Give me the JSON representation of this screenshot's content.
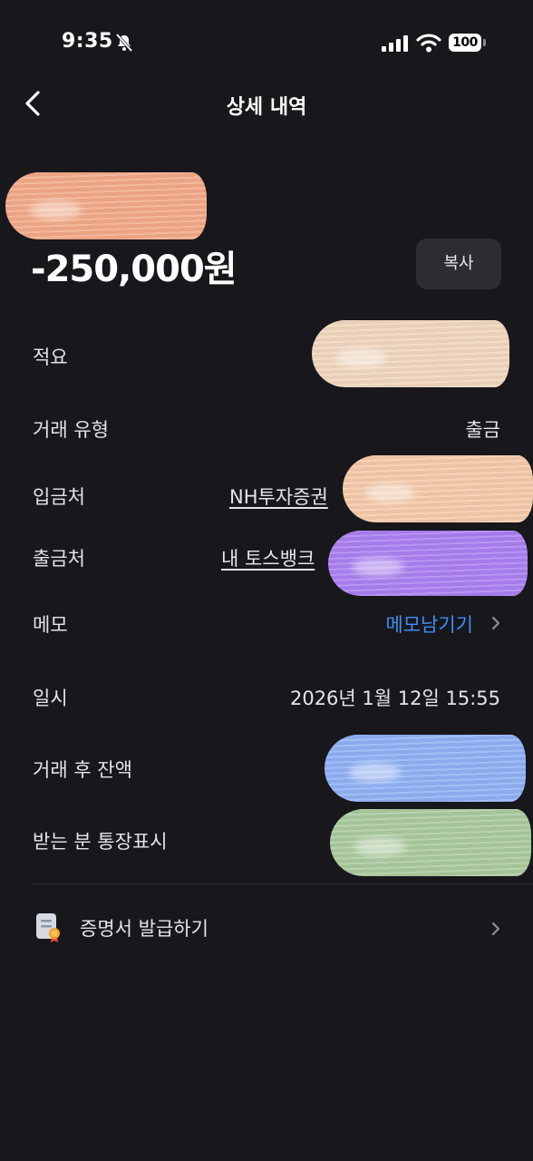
{
  "status_bar": {
    "time": "9:35",
    "battery": "100",
    "icons": [
      "bell-slash-icon",
      "cellular-signal-icon",
      "wifi-icon",
      "battery-icon"
    ]
  },
  "header": {
    "title": "상세 내역",
    "back_icon": "chevron-left-icon"
  },
  "transaction": {
    "amount": "-250,000원",
    "copy_label": "복사"
  },
  "details": {
    "summary_label": "적요",
    "type_label": "거래 유형",
    "type_value": "출금",
    "deposit_to_label": "입금처",
    "deposit_to_value": "NH투자증권",
    "withdraw_from_label": "출금처",
    "withdraw_from_value": "내 토스뱅크",
    "memo_label": "메모",
    "memo_action": "메모남기기",
    "datetime_label": "일시",
    "datetime_value": "2026년 1월 12일 15:55",
    "balance_after_label": "거래 후 잔액",
    "recipient_display_label": "받는 분 통장표시"
  },
  "certificate": {
    "label": "증명서 발급하기",
    "icon": "document-certificate-icon"
  },
  "colors": {
    "background": "#18171c",
    "accent_link": "#3e8ef6",
    "button_bg": "#2c2c33",
    "redaction_orange": "#f2a887",
    "redaction_beige": "#f0d6bd",
    "redaction_peach": "#f4c9a8",
    "redaction_purple": "#a97ff0",
    "redaction_blue": "#8fb0f4",
    "redaction_green": "#a9c99d"
  }
}
